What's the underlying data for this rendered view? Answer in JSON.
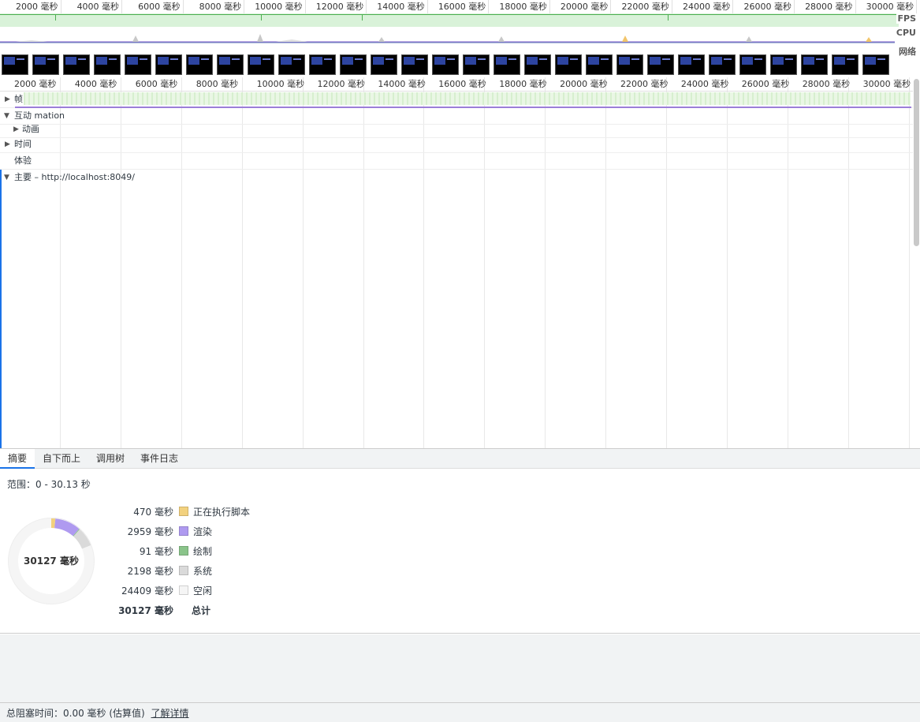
{
  "overview": {
    "ticks": [
      "2000 毫秒",
      "4000 毫秒",
      "6000 毫秒",
      "8000 毫秒",
      "10000 毫秒",
      "12000 毫秒",
      "14000 毫秒",
      "16000 毫秒",
      "18000 毫秒",
      "20000 毫秒",
      "22000 毫秒",
      "24000 毫秒",
      "26000 毫秒",
      "28000 毫秒",
      "30000 毫秒"
    ],
    "fps_label": "FPS",
    "cpu_label": "CPU",
    "network_label": "网络",
    "screenshot_count": 29
  },
  "timeline": {
    "ticks": [
      "2000 毫秒",
      "4000 毫秒",
      "6000 毫秒",
      "8000 毫秒",
      "10000 毫秒",
      "12000 毫秒",
      "14000 毫秒",
      "16000 毫秒",
      "18000 毫秒",
      "20000 毫秒",
      "22000 毫秒",
      "24000 毫秒",
      "26000 毫秒",
      "28000 毫秒",
      "30000 毫秒"
    ],
    "tracks": {
      "frames": "帧",
      "interactions": "互动 mation",
      "animations": "动画",
      "timings": "时间",
      "experience": "体验",
      "main": "主要 – http://localhost:8049/"
    }
  },
  "tabs": [
    "摘要",
    "自下而上",
    "调用树",
    "事件日志"
  ],
  "summary": {
    "range": "范围：0 - 30.13 秒",
    "total_center": "30127 毫秒",
    "items": [
      {
        "value": "470 毫秒",
        "name": "正在执行脚本",
        "color": "#f2d17e",
        "ms": 470
      },
      {
        "value": "2959 毫秒",
        "name": "渲染",
        "color": "#af9af0",
        "ms": 2959
      },
      {
        "value": "91 毫秒",
        "name": "绘制",
        "color": "#8ac48a",
        "ms": 91
      },
      {
        "value": "2198 毫秒",
        "name": "系统",
        "color": "#dadada",
        "ms": 2198
      },
      {
        "value": "24409 毫秒",
        "name": "空闲",
        "color": "#f5f5f5",
        "ms": 24409
      }
    ],
    "total": {
      "value": "30127 毫秒",
      "name": "总计"
    }
  },
  "footer": {
    "blocking": "总阻塞时间：0.00 毫秒 (估算值)",
    "learn_more": "了解详情"
  }
}
